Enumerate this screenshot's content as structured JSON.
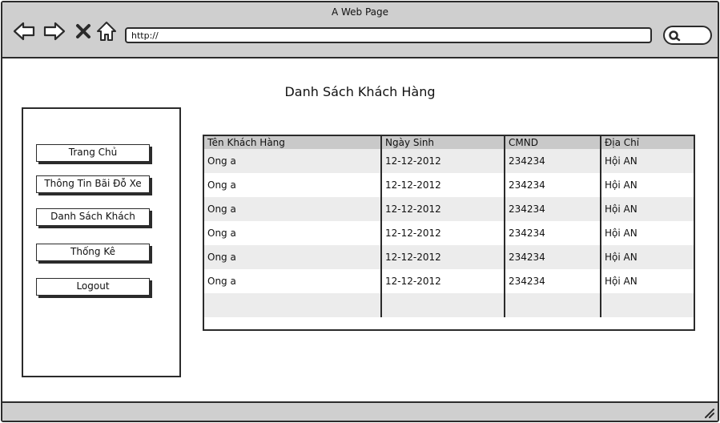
{
  "window": {
    "title": "A Web Page"
  },
  "browser": {
    "url": "http://",
    "icons": [
      "back-arrow-icon",
      "forward-arrow-icon",
      "close-icon",
      "home-icon",
      "search-icon"
    ]
  },
  "page": {
    "heading": "Danh Sách Khách Hàng"
  },
  "sidebar": {
    "buttons": [
      "Trang Chủ",
      "Thông Tin Bãi Đỗ Xe",
      "Danh Sách Khách",
      "Thống Kê",
      "Logout"
    ]
  },
  "table": {
    "headers": [
      "Tên Khách Hàng",
      "Ngày Sinh",
      "CMND",
      "Địa Chỉ"
    ],
    "rows": [
      [
        "Ong a",
        "12-12-2012",
        "234234",
        "Hội AN"
      ],
      [
        "Ong a",
        "12-12-2012",
        "234234",
        "Hội AN"
      ],
      [
        "Ong a",
        "12-12-2012",
        "234234",
        "Hội AN"
      ],
      [
        "Ong a",
        "12-12-2012",
        "234234",
        "Hội AN"
      ],
      [
        "Ong a",
        "12-12-2012",
        "234234",
        "Hội AN"
      ],
      [
        "Ong a",
        "12-12-2012",
        "234234",
        "Hội AN"
      ],
      [
        "",
        "",
        "",
        ""
      ]
    ]
  },
  "colors": {
    "chrome": "#cfcfcf",
    "stroke": "#2b2b2b",
    "row_alt": "#ececec",
    "header_bg": "#c9c9c9"
  }
}
